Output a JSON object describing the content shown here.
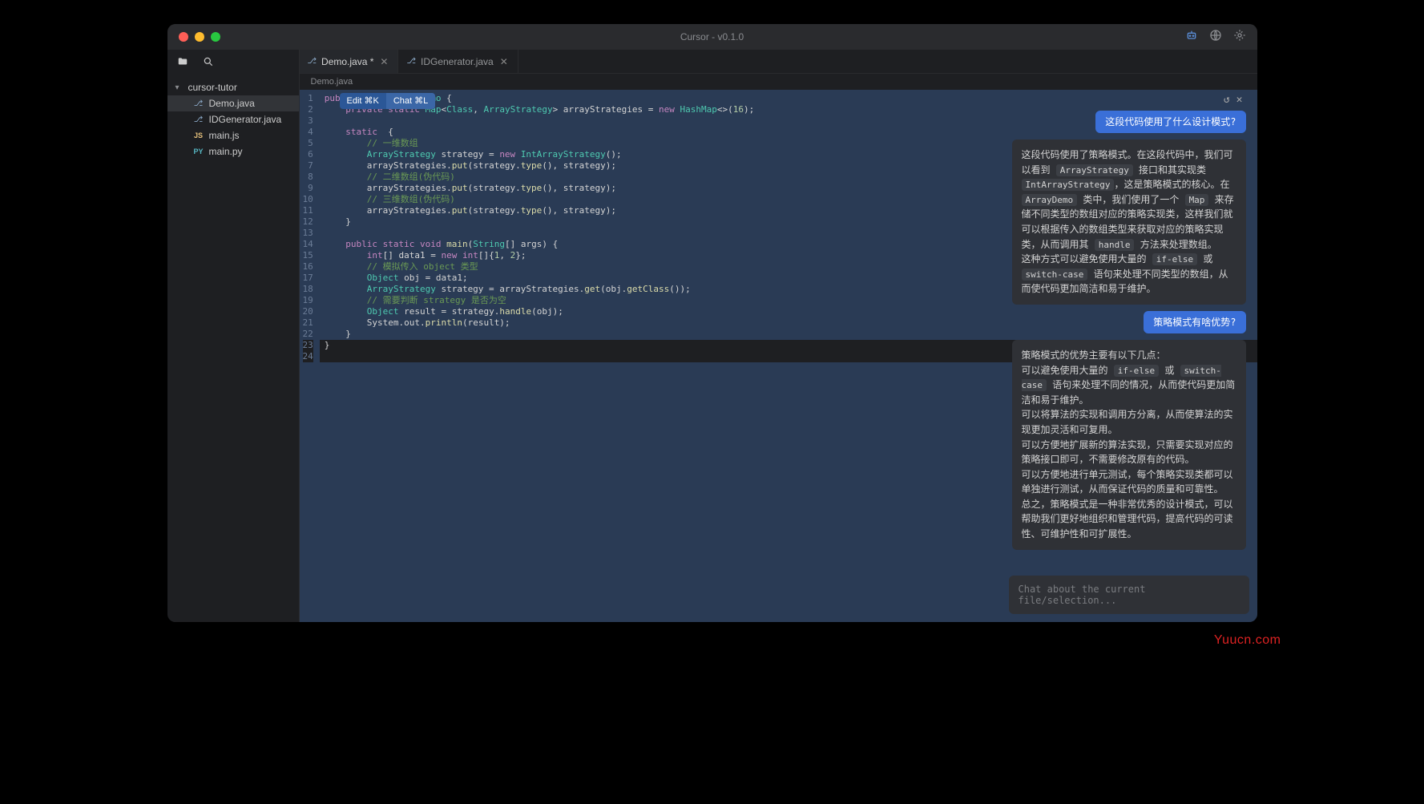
{
  "title": "Cursor - v0.1.0",
  "watermark": "Yuucn.com",
  "sidebar": {
    "root": "cursor-tutor",
    "items": [
      {
        "label": "Demo.java",
        "icon": "java",
        "active": true
      },
      {
        "label": "IDGenerator.java",
        "icon": "java",
        "active": false
      },
      {
        "label": "main.js",
        "icon": "js",
        "active": false
      },
      {
        "label": "main.py",
        "icon": "py",
        "active": false
      }
    ]
  },
  "tabs": [
    {
      "label": "Demo.java",
      "dirty": "*",
      "active": true
    },
    {
      "label": "IDGenerator.java",
      "dirty": "",
      "active": false
    }
  ],
  "breadcrumb": "Demo.java",
  "hint": {
    "edit": "Edit ⌘K",
    "chat": "Chat ⌘L"
  },
  "code": {
    "lines": [
      {
        "n": "1",
        "seg": [
          {
            "c": "kw",
            "t": "public class "
          },
          {
            "c": "ty",
            "t": "ArrayDemo"
          },
          {
            "c": "",
            "t": " {"
          }
        ]
      },
      {
        "n": "2",
        "seg": [
          {
            "c": "",
            "t": "    "
          },
          {
            "c": "kw",
            "t": "private static "
          },
          {
            "c": "ty",
            "t": "Map"
          },
          {
            "c": "",
            "t": "<"
          },
          {
            "c": "ty",
            "t": "Class"
          },
          {
            "c": "",
            "t": ", "
          },
          {
            "c": "ty",
            "t": "ArrayStrategy"
          },
          {
            "c": "",
            "t": "> arrayStrategies = "
          },
          {
            "c": "kw",
            "t": "new "
          },
          {
            "c": "ty",
            "t": "HashMap"
          },
          {
            "c": "",
            "t": "<>("
          },
          {
            "c": "nu",
            "t": "16"
          },
          {
            "c": "",
            "t": ");"
          }
        ]
      },
      {
        "n": "3",
        "seg": [
          {
            "c": "",
            "t": ""
          }
        ]
      },
      {
        "n": "4",
        "seg": [
          {
            "c": "",
            "t": "    "
          },
          {
            "c": "kw",
            "t": "static"
          },
          {
            "c": "",
            "t": "  {"
          }
        ]
      },
      {
        "n": "5",
        "seg": [
          {
            "c": "",
            "t": "        "
          },
          {
            "c": "cm",
            "t": "// 一维数组"
          }
        ]
      },
      {
        "n": "6",
        "seg": [
          {
            "c": "",
            "t": "        "
          },
          {
            "c": "ty",
            "t": "ArrayStrategy"
          },
          {
            "c": "",
            "t": " strategy = "
          },
          {
            "c": "kw",
            "t": "new "
          },
          {
            "c": "ty",
            "t": "IntArrayStrategy"
          },
          {
            "c": "",
            "t": "();"
          }
        ]
      },
      {
        "n": "7",
        "seg": [
          {
            "c": "",
            "t": "        arrayStrategies."
          },
          {
            "c": "fn",
            "t": "put"
          },
          {
            "c": "",
            "t": "(strategy."
          },
          {
            "c": "fn",
            "t": "type"
          },
          {
            "c": "",
            "t": "(), strategy);"
          }
        ]
      },
      {
        "n": "8",
        "seg": [
          {
            "c": "",
            "t": "        "
          },
          {
            "c": "cm",
            "t": "// 二维数组(伪代码)"
          }
        ]
      },
      {
        "n": "9",
        "seg": [
          {
            "c": "",
            "t": "        arrayStrategies."
          },
          {
            "c": "fn",
            "t": "put"
          },
          {
            "c": "",
            "t": "(strategy."
          },
          {
            "c": "fn",
            "t": "type"
          },
          {
            "c": "",
            "t": "(), strategy);"
          }
        ]
      },
      {
        "n": "10",
        "seg": [
          {
            "c": "",
            "t": "        "
          },
          {
            "c": "cm",
            "t": "// 三维数组(伪代码)"
          }
        ]
      },
      {
        "n": "11",
        "seg": [
          {
            "c": "",
            "t": "        arrayStrategies."
          },
          {
            "c": "fn",
            "t": "put"
          },
          {
            "c": "",
            "t": "(strategy."
          },
          {
            "c": "fn",
            "t": "type"
          },
          {
            "c": "",
            "t": "(), strategy);"
          }
        ]
      },
      {
        "n": "12",
        "seg": [
          {
            "c": "",
            "t": "    }"
          }
        ]
      },
      {
        "n": "13",
        "seg": [
          {
            "c": "",
            "t": ""
          }
        ]
      },
      {
        "n": "14",
        "seg": [
          {
            "c": "",
            "t": "    "
          },
          {
            "c": "kw",
            "t": "public static void "
          },
          {
            "c": "fn",
            "t": "main"
          },
          {
            "c": "",
            "t": "("
          },
          {
            "c": "ty",
            "t": "String"
          },
          {
            "c": "",
            "t": "[] args) {"
          }
        ]
      },
      {
        "n": "15",
        "seg": [
          {
            "c": "",
            "t": "        "
          },
          {
            "c": "kw",
            "t": "int"
          },
          {
            "c": "",
            "t": "[] data1 = "
          },
          {
            "c": "kw",
            "t": "new int"
          },
          {
            "c": "",
            "t": "[]{"
          },
          {
            "c": "nu",
            "t": "1"
          },
          {
            "c": "",
            "t": ", "
          },
          {
            "c": "nu",
            "t": "2"
          },
          {
            "c": "",
            "t": "};"
          }
        ]
      },
      {
        "n": "16",
        "seg": [
          {
            "c": "",
            "t": "        "
          },
          {
            "c": "cm",
            "t": "// 模拟传入 object 类型"
          }
        ]
      },
      {
        "n": "17",
        "seg": [
          {
            "c": "",
            "t": "        "
          },
          {
            "c": "ty",
            "t": "Object"
          },
          {
            "c": "",
            "t": " obj = data1;"
          }
        ]
      },
      {
        "n": "18",
        "seg": [
          {
            "c": "",
            "t": "        "
          },
          {
            "c": "ty",
            "t": "ArrayStrategy"
          },
          {
            "c": "",
            "t": " strategy = arrayStrategies."
          },
          {
            "c": "fn",
            "t": "get"
          },
          {
            "c": "",
            "t": "(obj."
          },
          {
            "c": "fn",
            "t": "getClass"
          },
          {
            "c": "",
            "t": "());"
          }
        ]
      },
      {
        "n": "19",
        "seg": [
          {
            "c": "",
            "t": "        "
          },
          {
            "c": "cm",
            "t": "// 需要判断 strategy 是否为空"
          }
        ]
      },
      {
        "n": "20",
        "seg": [
          {
            "c": "",
            "t": "        "
          },
          {
            "c": "ty",
            "t": "Object"
          },
          {
            "c": "",
            "t": " result = strategy."
          },
          {
            "c": "fn",
            "t": "handle"
          },
          {
            "c": "",
            "t": "(obj);"
          }
        ]
      },
      {
        "n": "21",
        "seg": [
          {
            "c": "",
            "t": "        System.out."
          },
          {
            "c": "fn",
            "t": "println"
          },
          {
            "c": "",
            "t": "(result);"
          }
        ]
      },
      {
        "n": "22",
        "seg": [
          {
            "c": "",
            "t": "    }"
          }
        ]
      },
      {
        "n": "23",
        "seg": [
          {
            "c": "",
            "t": "}"
          }
        ],
        "nonsel": true
      },
      {
        "n": "24",
        "seg": [
          {
            "c": "",
            "t": ""
          }
        ],
        "nonsel": true
      }
    ]
  },
  "chat": {
    "messages": [
      {
        "role": "user",
        "text": "这段代码使用了什么设计模式?"
      },
      {
        "role": "ai",
        "parts": [
          {
            "t": "这段代码使用了策略模式。"
          },
          {
            "t": "在这段代码中，我们可以看到 "
          },
          {
            "code": "ArrayStrategy"
          },
          {
            "t": " 接口和其实现类 "
          },
          {
            "code": "IntArrayStrategy"
          },
          {
            "t": "，这是策略模式的核心。在 "
          },
          {
            "code": "ArrayDemo"
          },
          {
            "t": " 类中，我们使用了一个 "
          },
          {
            "code": "Map"
          },
          {
            "t": " 来存储不同类型的数组对应的策略实现类，这样我们就可以根据传入的数组类型来获取对应的策略实现类，从而调用其 "
          },
          {
            "code": "handle"
          },
          {
            "t": " 方法来处理数组。"
          },
          {
            "br": true
          },
          {
            "t": "这种方式可以避免使用大量的 "
          },
          {
            "code": "if-else"
          },
          {
            "t": " 或 "
          },
          {
            "code": "switch-case"
          },
          {
            "t": " 语句来处理不同类型的数组，从而使代码更加简洁和易于维护。"
          }
        ]
      },
      {
        "role": "user",
        "text": "策略模式有啥优势?"
      },
      {
        "role": "ai",
        "parts": [
          {
            "t": "策略模式的优势主要有以下几点："
          },
          {
            "br": true
          },
          {
            "t": "可以避免使用大量的 "
          },
          {
            "code": "if-else"
          },
          {
            "t": " 或 "
          },
          {
            "code": "switch-case"
          },
          {
            "t": " 语句来处理不同的情况，从而使代码更加简洁和易于维护。"
          },
          {
            "br": true
          },
          {
            "t": "可以将算法的实现和调用方分离，从而使算法的实现更加灵活和可复用。"
          },
          {
            "br": true
          },
          {
            "t": "可以方便地扩展新的算法实现，只需要实现对应的策略接口即可，不需要修改原有的代码。"
          },
          {
            "br": true
          },
          {
            "t": "可以方便地进行单元测试，每个策略实现类都可以单独进行测试，从而保证代码的质量和可靠性。"
          },
          {
            "br": true
          },
          {
            "t": "总之，策略模式是一种非常优秀的设计模式，可以帮助我们更好地组织和管理代码，提高代码的可读性、可维护性和可扩展性。"
          }
        ]
      }
    ],
    "input_placeholder": "Chat about the current file/selection..."
  }
}
